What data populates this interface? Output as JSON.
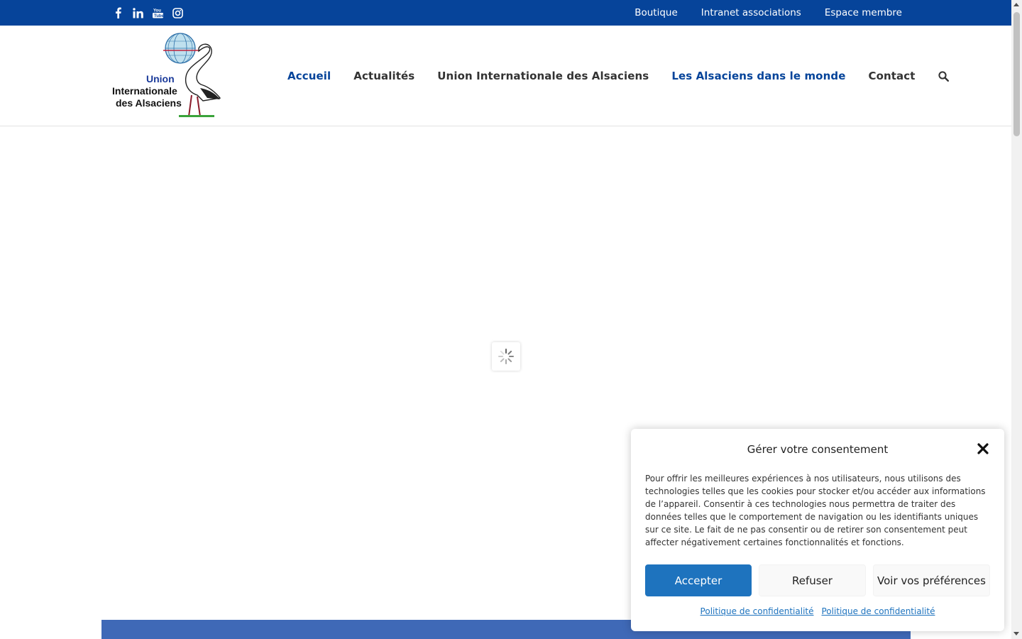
{
  "topbar": {
    "background": "#06449a",
    "social": [
      {
        "icon": "facebook-icon"
      },
      {
        "icon": "linkedin-icon"
      },
      {
        "icon": "youtube-icon"
      },
      {
        "icon": "instagram-icon"
      }
    ],
    "links": [
      "Boutique",
      "Intranet associations",
      "Espace membre"
    ]
  },
  "header": {
    "logo": {
      "line1": "Union",
      "line2": "Internationale",
      "line3": "des Alsaciens"
    },
    "nav": [
      {
        "label": "Accueil",
        "active": true
      },
      {
        "label": "Actualités",
        "active": false
      },
      {
        "label": "Union Internationale des Alsaciens",
        "active": false
      },
      {
        "label": "Les Alsaciens dans le monde",
        "active": true
      },
      {
        "label": "Contact",
        "active": false
      }
    ],
    "search_icon": "search-icon",
    "accent": "#06449a"
  },
  "consent": {
    "title": "Gérer votre consentement",
    "text": "Pour offrir les meilleures expériences à nos utilisateurs, nous utilisons des technologies telles que les cookies pour stocker et/ou accéder aux informations de l’appareil. Consentir à ces technologies nous permettra de traiter des données telles que le comportement de navigation ou les identifiants uniques sur ce site. Le fait de ne pas consentir ou de retirer son consentement peut affecter négativement certaines fonctionnalités et fonctions.",
    "accept": "Accepter",
    "refuse": "Refuser",
    "preferences": "Voir vos préférences",
    "policy1": "Politique de confidentialité",
    "policy2": "Politique de confidentialité",
    "accent": "#1e73be"
  }
}
